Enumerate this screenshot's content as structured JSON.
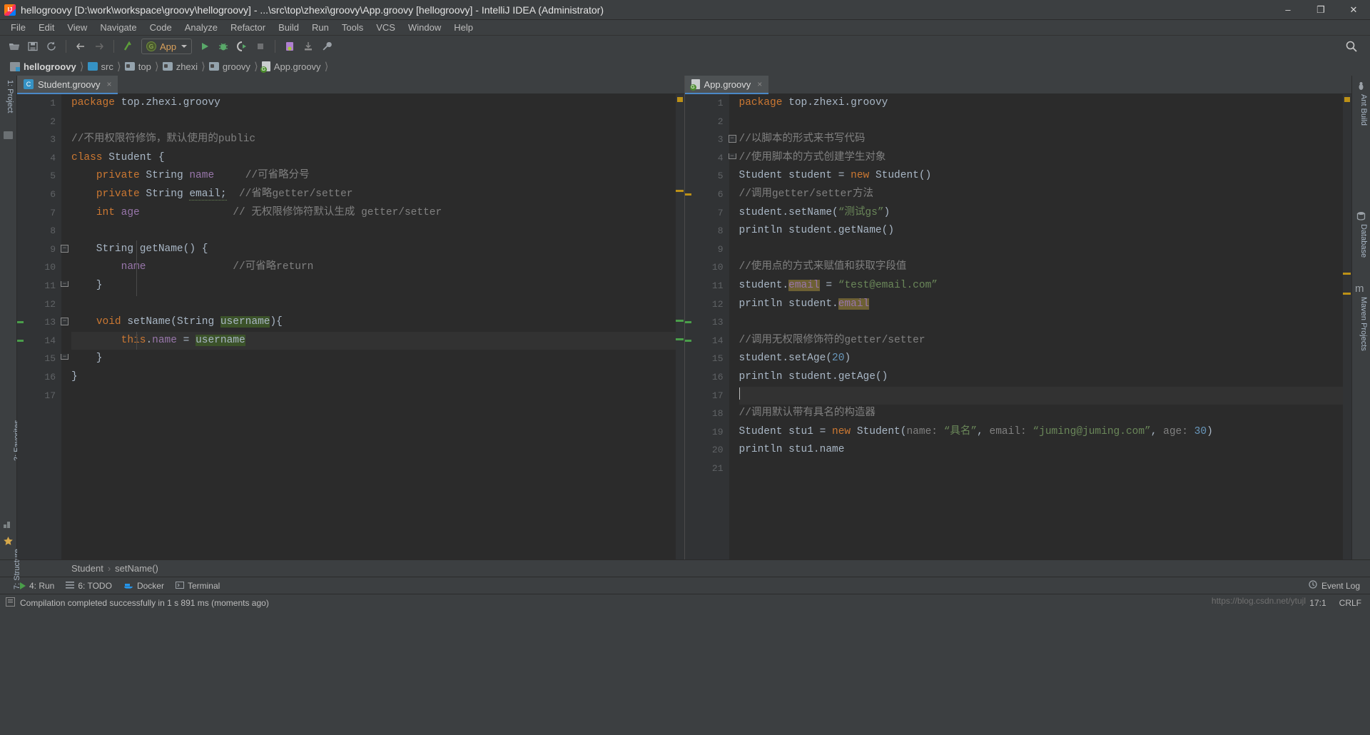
{
  "window": {
    "title": "hellogroovy [D:\\work\\workspace\\groovy\\hellogroovy] - ...\\src\\top\\zhexi\\groovy\\App.groovy [hellogroovy] - IntelliJ IDEA (Administrator)",
    "minimize": "–",
    "maximize": "❐",
    "close": "✕"
  },
  "menu": [
    "File",
    "Edit",
    "View",
    "Navigate",
    "Code",
    "Analyze",
    "Refactor",
    "Build",
    "Run",
    "Tools",
    "VCS",
    "Window",
    "Help"
  ],
  "toolbar": {
    "open_label": "open-folder-icon",
    "save_label": "save-icon",
    "sync_label": "sync-icon",
    "back_label": "back-arrow-icon",
    "forward_label": "forward-arrow-icon",
    "run_config": "App",
    "run_config_badge": "G",
    "search_label": "search-icon"
  },
  "breadcrumb": [
    {
      "label": "hellogroovy",
      "icon": "module-icon"
    },
    {
      "label": "src",
      "icon": "source-folder-icon"
    },
    {
      "label": "top",
      "icon": "folder-icon"
    },
    {
      "label": "zhexi",
      "icon": "folder-icon"
    },
    {
      "label": "groovy",
      "icon": "folder-icon"
    },
    {
      "label": "App.groovy",
      "icon": "groovy-file-icon"
    }
  ],
  "left_rail": [
    "1: Project",
    "7: Structure",
    "2: Favorites"
  ],
  "right_rail": [
    "Ant Build",
    "Database",
    "Maven Projects"
  ],
  "editors": {
    "left": {
      "tab": "Student.groovy",
      "tab_icon": "class-file-icon",
      "close_label": "×",
      "line_count": 17,
      "lines": [
        {
          "n": 1,
          "segs": [
            {
              "t": "package",
              "c": "kw"
            },
            {
              "t": " top.zhexi.groovy",
              "c": "plain"
            }
          ]
        },
        {
          "n": 2,
          "segs": []
        },
        {
          "n": 3,
          "segs": [
            {
              "t": "//不用权限符修饰，默认使用的public",
              "c": "cmt"
            }
          ]
        },
        {
          "n": 4,
          "segs": [
            {
              "t": "class",
              "c": "kw"
            },
            {
              "t": " Student {",
              "c": "plain"
            }
          ]
        },
        {
          "n": 5,
          "segs": [
            {
              "t": "    ",
              "c": "plain"
            },
            {
              "t": "private",
              "c": "kw"
            },
            {
              "t": " String ",
              "c": "plain"
            },
            {
              "t": "name",
              "c": "fld"
            },
            {
              "t": "     ",
              "c": "plain"
            },
            {
              "t": "//可省略分号",
              "c": "cmt"
            }
          ]
        },
        {
          "n": 6,
          "segs": [
            {
              "t": "    ",
              "c": "plain"
            },
            {
              "t": "private",
              "c": "kw"
            },
            {
              "t": " String ",
              "c": "plain"
            },
            {
              "t": "email;",
              "c": "plain squig"
            },
            {
              "t": "  ",
              "c": "plain"
            },
            {
              "t": "//省略getter/setter",
              "c": "cmt"
            }
          ]
        },
        {
          "n": 7,
          "segs": [
            {
              "t": "    ",
              "c": "plain"
            },
            {
              "t": "int",
              "c": "kw"
            },
            {
              "t": " ",
              "c": "plain"
            },
            {
              "t": "age",
              "c": "fld"
            },
            {
              "t": "               ",
              "c": "plain"
            },
            {
              "t": "// 无权限修饰符默认生成 getter/setter",
              "c": "cmt"
            }
          ]
        },
        {
          "n": 8,
          "segs": []
        },
        {
          "n": 9,
          "segs": [
            {
              "t": "    String getName() {",
              "c": "plain"
            }
          ],
          "fold": "minus"
        },
        {
          "n": 10,
          "segs": [
            {
              "t": "        ",
              "c": "plain"
            },
            {
              "t": "name",
              "c": "fld"
            },
            {
              "t": "              ",
              "c": "plain"
            },
            {
              "t": "//可省略return",
              "c": "cmt"
            }
          ]
        },
        {
          "n": 11,
          "segs": [
            {
              "t": "    }",
              "c": "plain"
            }
          ],
          "fold": "end"
        },
        {
          "n": 12,
          "segs": []
        },
        {
          "n": 13,
          "segs": [
            {
              "t": "    ",
              "c": "plain"
            },
            {
              "t": "void",
              "c": "kw"
            },
            {
              "t": " setName(String ",
              "c": "plain"
            },
            {
              "t": "username",
              "c": "plain hl-green"
            },
            {
              "t": "){",
              "c": "plain"
            }
          ],
          "fold": "minus",
          "gutter_mark": "green"
        },
        {
          "n": 14,
          "segs": [
            {
              "t": "        ",
              "c": "plain"
            },
            {
              "t": "this",
              "c": "kw"
            },
            {
              "t": ".",
              "c": "plain"
            },
            {
              "t": "name",
              "c": "fld"
            },
            {
              "t": " ",
              "c": "plain"
            },
            {
              "t": "=",
              "c": "plain"
            },
            {
              "t": " ",
              "c": "plain"
            },
            {
              "t": "username",
              "c": "plain hl-green"
            }
          ],
          "caret": true,
          "gutter_mark": "green"
        },
        {
          "n": 15,
          "segs": [
            {
              "t": "    }",
              "c": "plain"
            }
          ],
          "fold": "end"
        },
        {
          "n": 16,
          "segs": [
            {
              "t": "}",
              "c": "plain"
            }
          ]
        },
        {
          "n": 17,
          "segs": []
        }
      ]
    },
    "right": {
      "tab": "App.groovy",
      "tab_icon": "groovy-file-icon",
      "close_label": "×",
      "line_count": 21,
      "lines": [
        {
          "n": 1,
          "segs": [
            {
              "t": "package",
              "c": "kw"
            },
            {
              "t": " top.zhexi.groovy",
              "c": "plain"
            }
          ]
        },
        {
          "n": 2,
          "segs": []
        },
        {
          "n": 3,
          "segs": [
            {
              "t": "//以脚本的形式来书写代码",
              "c": "cmt"
            }
          ],
          "fold": "minus"
        },
        {
          "n": 4,
          "segs": [
            {
              "t": "//使用脚本的方式创建学生对象",
              "c": "cmt"
            }
          ],
          "fold": "end"
        },
        {
          "n": 5,
          "segs": [
            {
              "t": "Student student = ",
              "c": "plain"
            },
            {
              "t": "new",
              "c": "kw"
            },
            {
              "t": " Student()",
              "c": "plain"
            }
          ]
        },
        {
          "n": 6,
          "segs": [
            {
              "t": "//调用getter/setter方法",
              "c": "cmt"
            }
          ],
          "gutter_mark": "yellow"
        },
        {
          "n": 7,
          "segs": [
            {
              "t": "student.setName(",
              "c": "plain"
            },
            {
              "t": "“测试gs”",
              "c": "str"
            },
            {
              "t": ")",
              "c": "plain"
            }
          ]
        },
        {
          "n": 8,
          "segs": [
            {
              "t": "println student.getName()",
              "c": "plain"
            }
          ]
        },
        {
          "n": 9,
          "segs": []
        },
        {
          "n": 10,
          "segs": [
            {
              "t": "//使用点的方式来赋值和获取字段值",
              "c": "cmt"
            }
          ]
        },
        {
          "n": 11,
          "segs": [
            {
              "t": "student.",
              "c": "plain"
            },
            {
              "t": "email",
              "c": "fld hl-olive"
            },
            {
              "t": " = ",
              "c": "plain"
            },
            {
              "t": "“test@email.com”",
              "c": "str"
            }
          ]
        },
        {
          "n": 12,
          "segs": [
            {
              "t": "println student.",
              "c": "plain"
            },
            {
              "t": "email",
              "c": "fld hl-olive"
            }
          ]
        },
        {
          "n": 13,
          "segs": [],
          "gutter_mark": "green"
        },
        {
          "n": 14,
          "segs": [
            {
              "t": "//调用无权限修饰符的getter/setter",
              "c": "cmt"
            }
          ],
          "gutter_mark": "green"
        },
        {
          "n": 15,
          "segs": [
            {
              "t": "student.setAge(",
              "c": "plain"
            },
            {
              "t": "20",
              "c": "num"
            },
            {
              "t": ")",
              "c": "plain"
            }
          ]
        },
        {
          "n": 16,
          "segs": [
            {
              "t": "println student.getAge()",
              "c": "plain"
            }
          ]
        },
        {
          "n": 17,
          "segs": [],
          "caret": true
        },
        {
          "n": 18,
          "segs": [
            {
              "t": "//调用默认带有具名的构造器",
              "c": "cmt"
            }
          ]
        },
        {
          "n": 19,
          "segs": [
            {
              "t": "Student stu1 = ",
              "c": "plain"
            },
            {
              "t": "new",
              "c": "kw"
            },
            {
              "t": " Student(",
              "c": "plain"
            },
            {
              "t": "name:",
              "c": "cmt"
            },
            {
              "t": " ",
              "c": "plain"
            },
            {
              "t": "“具名”",
              "c": "str"
            },
            {
              "t": ", ",
              "c": "plain"
            },
            {
              "t": "email:",
              "c": "cmt"
            },
            {
              "t": " ",
              "c": "plain"
            },
            {
              "t": "“juming@juming.com”",
              "c": "str"
            },
            {
              "t": ", ",
              "c": "plain"
            },
            {
              "t": "age:",
              "c": "cmt"
            },
            {
              "t": " ",
              "c": "plain"
            },
            {
              "t": "30",
              "c": "num"
            },
            {
              "t": ")",
              "c": "plain"
            }
          ]
        },
        {
          "n": 20,
          "segs": [
            {
              "t": "println stu1.",
              "c": "plain"
            },
            {
              "t": "name",
              "c": "plain"
            }
          ]
        },
        {
          "n": 21,
          "segs": []
        }
      ]
    }
  },
  "nav_bottom": {
    "class": "Student",
    "method": "setName()",
    "separator": "›"
  },
  "toolwindows": {
    "run": "4: Run",
    "todo": "6: TODO",
    "docker": "Docker",
    "terminal": "Terminal",
    "event_log": "Event Log"
  },
  "status": {
    "message": "Compilation completed successfully in 1 s 891 ms (moments ago)",
    "caret": "17:1",
    "encoding": "CRLF",
    "watermark": "https://blog.csdn.net/ytujl"
  }
}
